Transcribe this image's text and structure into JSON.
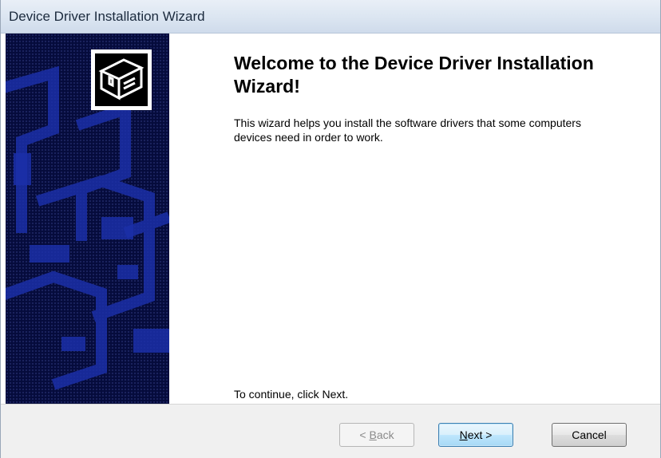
{
  "window": {
    "title": "Device Driver Installation Wizard"
  },
  "banner": {
    "icon": "hardware-device-icon"
  },
  "content": {
    "heading": "Welcome to the Device Driver Installation Wizard!",
    "description": "This wizard helps you install the software drivers that some computers devices need in order to work.",
    "continue_text": "To continue, click Next."
  },
  "buttons": {
    "back": {
      "prefix": "< ",
      "mnemonic": "B",
      "rest": "ack",
      "enabled": false
    },
    "next": {
      "mnemonic": "N",
      "rest": "ext >",
      "default": true
    },
    "cancel": {
      "label": "Cancel"
    }
  },
  "colors": {
    "banner_bg": "#050b3c",
    "banner_pattern": "#1a2a9a",
    "titlebar": "#dbe5f1",
    "footer": "#f0f0f0"
  }
}
